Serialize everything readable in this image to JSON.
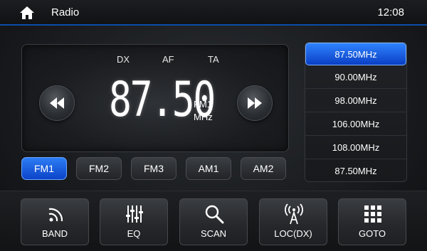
{
  "header": {
    "title": "Radio",
    "time": "12:08"
  },
  "display": {
    "flags": [
      "DX",
      "AF",
      "TA"
    ],
    "frequency": "87.50",
    "band": "FM1",
    "unit": "MHz"
  },
  "bands": [
    {
      "label": "FM1",
      "active": true
    },
    {
      "label": "FM2",
      "active": false
    },
    {
      "label": "FM3",
      "active": false
    },
    {
      "label": "AM1",
      "active": false
    },
    {
      "label": "AM2",
      "active": false
    }
  ],
  "presets": [
    {
      "label": "87.50MHz",
      "active": true
    },
    {
      "label": "90.00MHz",
      "active": false
    },
    {
      "label": "98.00MHz",
      "active": false
    },
    {
      "label": "106.00MHz",
      "active": false
    },
    {
      "label": "108.00MHz",
      "active": false
    },
    {
      "label": "87.50MHz",
      "active": false
    }
  ],
  "functions": [
    {
      "label": "BAND",
      "icon": "band-signal-icon"
    },
    {
      "label": "EQ",
      "icon": "equalizer-icon"
    },
    {
      "label": "SCAN",
      "icon": "search-icon"
    },
    {
      "label": "LOC(DX)",
      "icon": "antenna-icon"
    },
    {
      "label": "GOTO",
      "icon": "keypad-icon"
    }
  ],
  "colors": {
    "accent": "#1a5fe6",
    "header_rule": "#0b4ea8"
  }
}
